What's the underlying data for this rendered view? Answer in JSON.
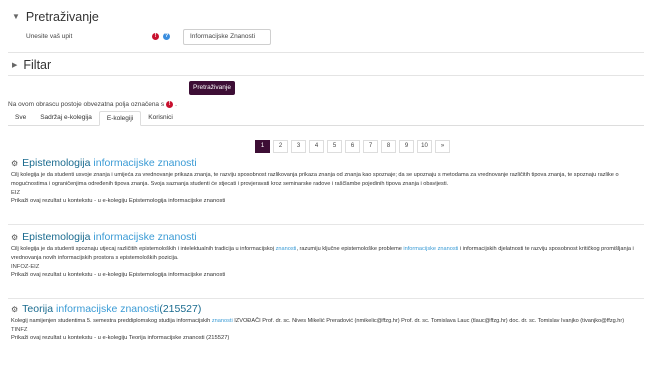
{
  "search_section": {
    "title": "Pretraživanje",
    "query_label": "Unesite vaš upit",
    "query_value": "Informacijske Znanosti"
  },
  "filter_section": {
    "title": "Filtar"
  },
  "search_button": "Pretraživanje",
  "required_note": "Na ovom obrascu postoje obvezatna polja označena s",
  "tabs": [
    {
      "label": "Sve"
    },
    {
      "label": "Sadržaj e-kolegija"
    },
    {
      "label": "E-kolegiji"
    },
    {
      "label": "Korisnici"
    }
  ],
  "active_tab": "E-kolegiji",
  "pagination": [
    "1",
    "2",
    "3",
    "4",
    "5",
    "6",
    "7",
    "8",
    "9",
    "10",
    "»"
  ],
  "results": [
    {
      "title_plain": "Epistemologija ",
      "title_highlight": "informacijske znanosti",
      "title_suffix": "",
      "desc_pre": "Cilj kolegija je da studenti usvoje znanja i umijeća za vrednovanje prikaza znanja, te razviju sposobnost razlikovanja prikaza znanja od znanja kao spoznaje; da se upoznaju s metodama za vrednovanje različitih tipova znanja, te spoznaju razlike o mogućnostima i ograničenjima određenih tipova znanja. Svoja saznanja studenti će stjecati i provjeravati kroz seminarske radove i raščlambe pojedinih tipova znanja i obavijesti.",
      "desc_hl": "",
      "desc_post": "",
      "desc_hl2": "",
      "desc_post2": "",
      "code": "EIZ",
      "context": "Prikaži ovaj rezultat u kontekstu - u e-kolegiju Epistemologija informacijske znanosti"
    },
    {
      "title_plain": "Epistemologija ",
      "title_highlight": "informacijske znanosti",
      "title_suffix": "",
      "desc_pre": "Cilj kolegija je da studenti spoznaju utjecaj različitih epistemoloških i intelektualnih tradicija u informacijskoj ",
      "desc_hl": "znanosti",
      "desc_post": ", razumiju ključne epistemološke probleme ",
      "desc_hl2": "informacijske znanosti",
      "desc_post2": " i informacijskih djelatnosti te razviju sposobnost kritičkog promišljanja i vrednovanja novih informacijskih prostora s epistemoloških pozicija.",
      "code": "INFOZ-EIZ",
      "context": "Prikaži ovaj rezultat u kontekstu - u e-kolegiju Epistemologija informacijske znanosti"
    },
    {
      "title_plain": "Teorija ",
      "title_highlight": "informacijske znanosti",
      "title_suffix": " (215527)",
      "desc_pre": "Kolegij namijenjen studentima 5. semestra preddiplomskog studija informacijskih ",
      "desc_hl": "znanosti",
      "desc_post": " IZVOĐAČI Prof. dr. sc. Nives Mikelić Preradović (nmikelic@ffzg.hr) Prof. dr. sc. Tomislava Lauc (tlauc@ffzg.hr) doc. dr. sc. Tomislav Ivanjko (tivanjko@ffzg.hr)",
      "desc_hl2": "",
      "desc_post2": "",
      "code": "TINFZ",
      "context": "Prikaži ovaj rezultat u kontekstu - u e-kolegiju Teorija informacijske znanosti (215527)"
    }
  ]
}
